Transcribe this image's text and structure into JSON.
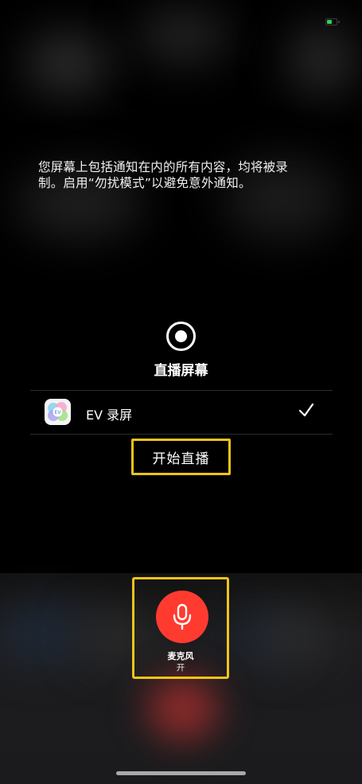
{
  "status": {
    "battery_color": "#2fd158",
    "battery_level": 0.4
  },
  "notice": {
    "text": "您屏幕上包括通知在内的所有内容，均将被录制。启用“勿扰模式”以避免意外通知。"
  },
  "broadcast": {
    "icon": "screen-broadcast-icon",
    "title": "直播屏幕",
    "apps": [
      {
        "name": "EV 录屏",
        "icon": "ev-recorder-app-icon",
        "selected": true
      }
    ],
    "start_label": "开始直播"
  },
  "microphone": {
    "icon": "microphone-icon",
    "label": "麦克风",
    "state": "开",
    "color": "#ff3b30"
  },
  "highlight_color": "#f0c419"
}
